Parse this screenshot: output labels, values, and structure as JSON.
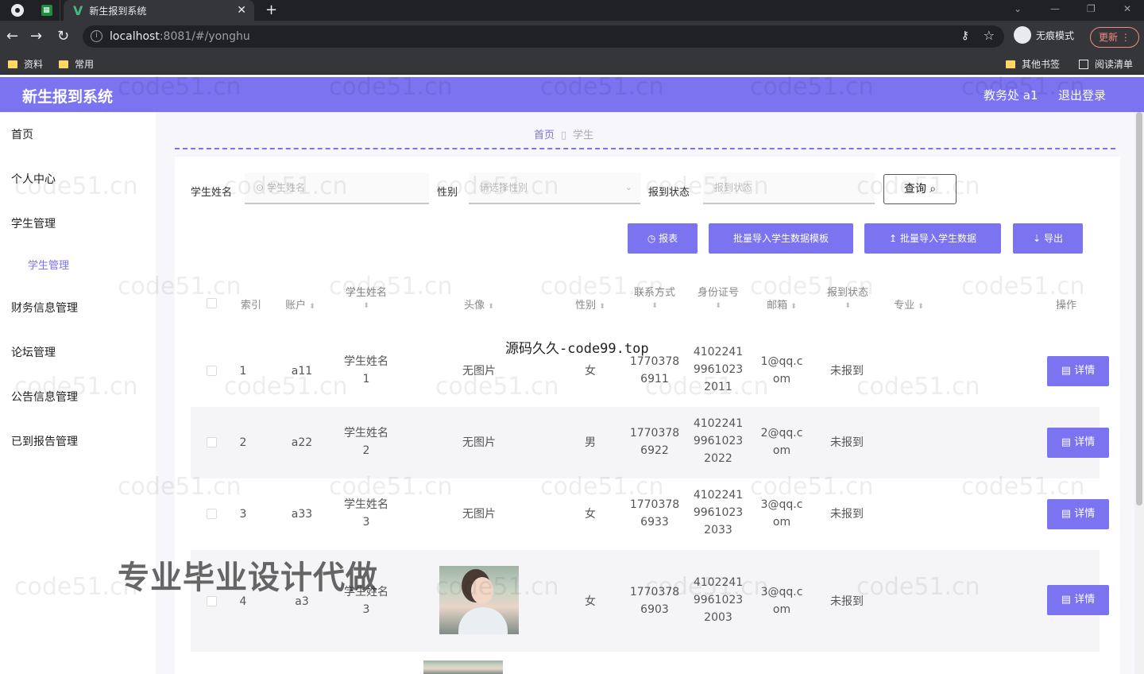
{
  "browser": {
    "tab_title": "新生报到系统",
    "url_host": "localhost",
    "url_path": ":8081/#/yonghu",
    "incognito_label": "无痕模式",
    "update_label": "更新",
    "bookmarks": [
      "资料",
      "常用"
    ],
    "bookmarks_right": [
      "其他书签",
      "阅读清单"
    ]
  },
  "header": {
    "title": "新生报到系统",
    "user": "教务处 a1",
    "logout": "退出登录"
  },
  "sidebar": {
    "items": [
      "首页",
      "个人中心",
      "学生管理",
      "财务信息管理",
      "论坛管理",
      "公告信息管理",
      "已到报告管理"
    ],
    "sub_item": "学生管理"
  },
  "breadcrumb": {
    "home": "首页",
    "current": "学生"
  },
  "filters": {
    "name_label": "学生姓名",
    "name_placeholder": "学生姓名",
    "gender_label": "性别",
    "gender_placeholder": "请选择性别",
    "status_label": "报到状态",
    "status_placeholder": "报到状态",
    "query_label": "查询"
  },
  "actions": {
    "report": "报表",
    "template": "批量导入学生数据模板",
    "import": "批量导入学生数据",
    "export": "导出"
  },
  "table": {
    "headers": {
      "index": "索引",
      "account": "账户",
      "name": "学生姓名",
      "avatar": "头像",
      "gender": "性别",
      "contact": "联系方式",
      "idcard": "身份证号",
      "email": "邮箱",
      "status": "报到状态",
      "major": "专业",
      "op": "操作"
    },
    "detail_label": "详情",
    "rows": [
      {
        "index": "1",
        "account": "a11",
        "name1": "学生姓名",
        "name2": "1",
        "avatar": "无图片",
        "gender": "女",
        "phone1": "1770378",
        "phone2": "6911",
        "id1": "4102241",
        "id2": "9961023",
        "id3": "2011",
        "email1": "1@qq.c",
        "email2": "om",
        "status": "未报到"
      },
      {
        "index": "2",
        "account": "a22",
        "name1": "学生姓名",
        "name2": "2",
        "avatar": "无图片",
        "gender": "男",
        "phone1": "1770378",
        "phone2": "6922",
        "id1": "4102241",
        "id2": "9961023",
        "id3": "2022",
        "email1": "2@qq.c",
        "email2": "om",
        "status": "未报到"
      },
      {
        "index": "3",
        "account": "a33",
        "name1": "学生姓名",
        "name2": "3",
        "avatar": "无图片",
        "gender": "女",
        "phone1": "1770378",
        "phone2": "6933",
        "id1": "4102241",
        "id2": "9961023",
        "id3": "2033",
        "email1": "3@qq.c",
        "email2": "om",
        "status": "未报到"
      },
      {
        "index": "4",
        "account": "a3",
        "name1": "学生姓名",
        "name2": "3",
        "avatar": "",
        "gender": "女",
        "phone1": "1770378",
        "phone2": "6903",
        "id1": "4102241",
        "id2": "9961023",
        "id3": "2003",
        "email1": "3@qq.c",
        "email2": "om",
        "status": "未报到"
      }
    ]
  },
  "overlay": {
    "watermark": "code51.cn",
    "center_text": "源码久久-code99.top",
    "promo": "专业毕业设计代做"
  }
}
